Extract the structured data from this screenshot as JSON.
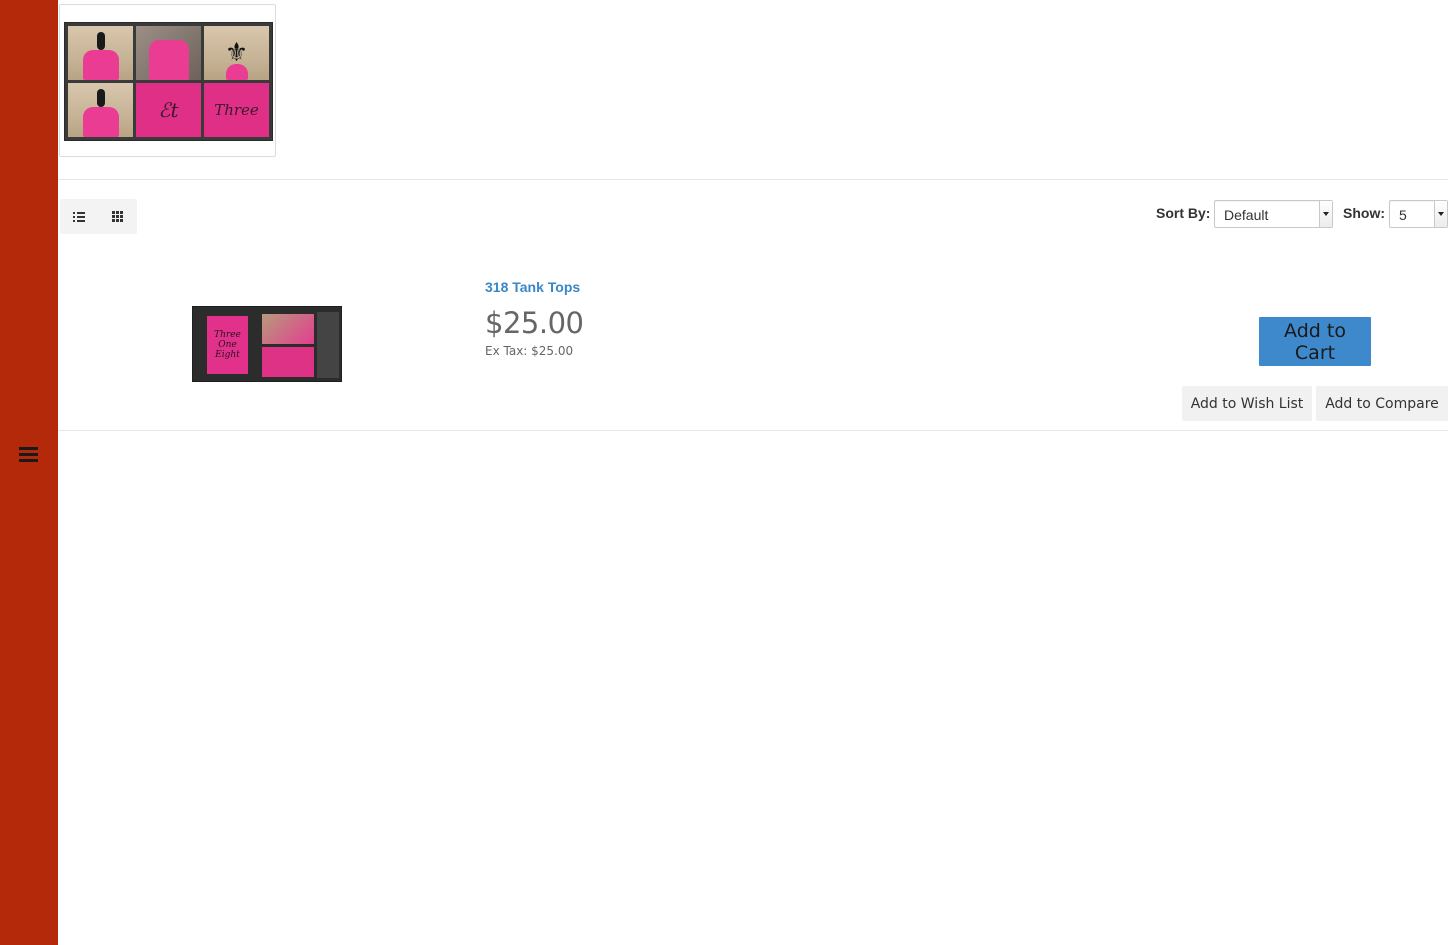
{
  "sidebar": {
    "menu_icon": "hamburger-menu-icon",
    "color": "#b5290b"
  },
  "category": {
    "image_icon": "category-collage-image"
  },
  "toolbar": {
    "list_view_icon": "list-view-icon",
    "grid_view_icon": "grid-view-icon",
    "sort_label": "Sort By:",
    "sort_value": "Default",
    "show_label": "Show:",
    "show_value": "5"
  },
  "product": {
    "name": "318 Tank Tops",
    "price": "$25.00",
    "ex_tax": "Ex Tax: $25.00",
    "add_to_cart": "Add to Cart",
    "add_to_wishlist": "Add to Wish List",
    "add_to_compare": "Add to Compare",
    "link_color": "#3a87c7",
    "cart_button_color": "#3d89cc"
  }
}
